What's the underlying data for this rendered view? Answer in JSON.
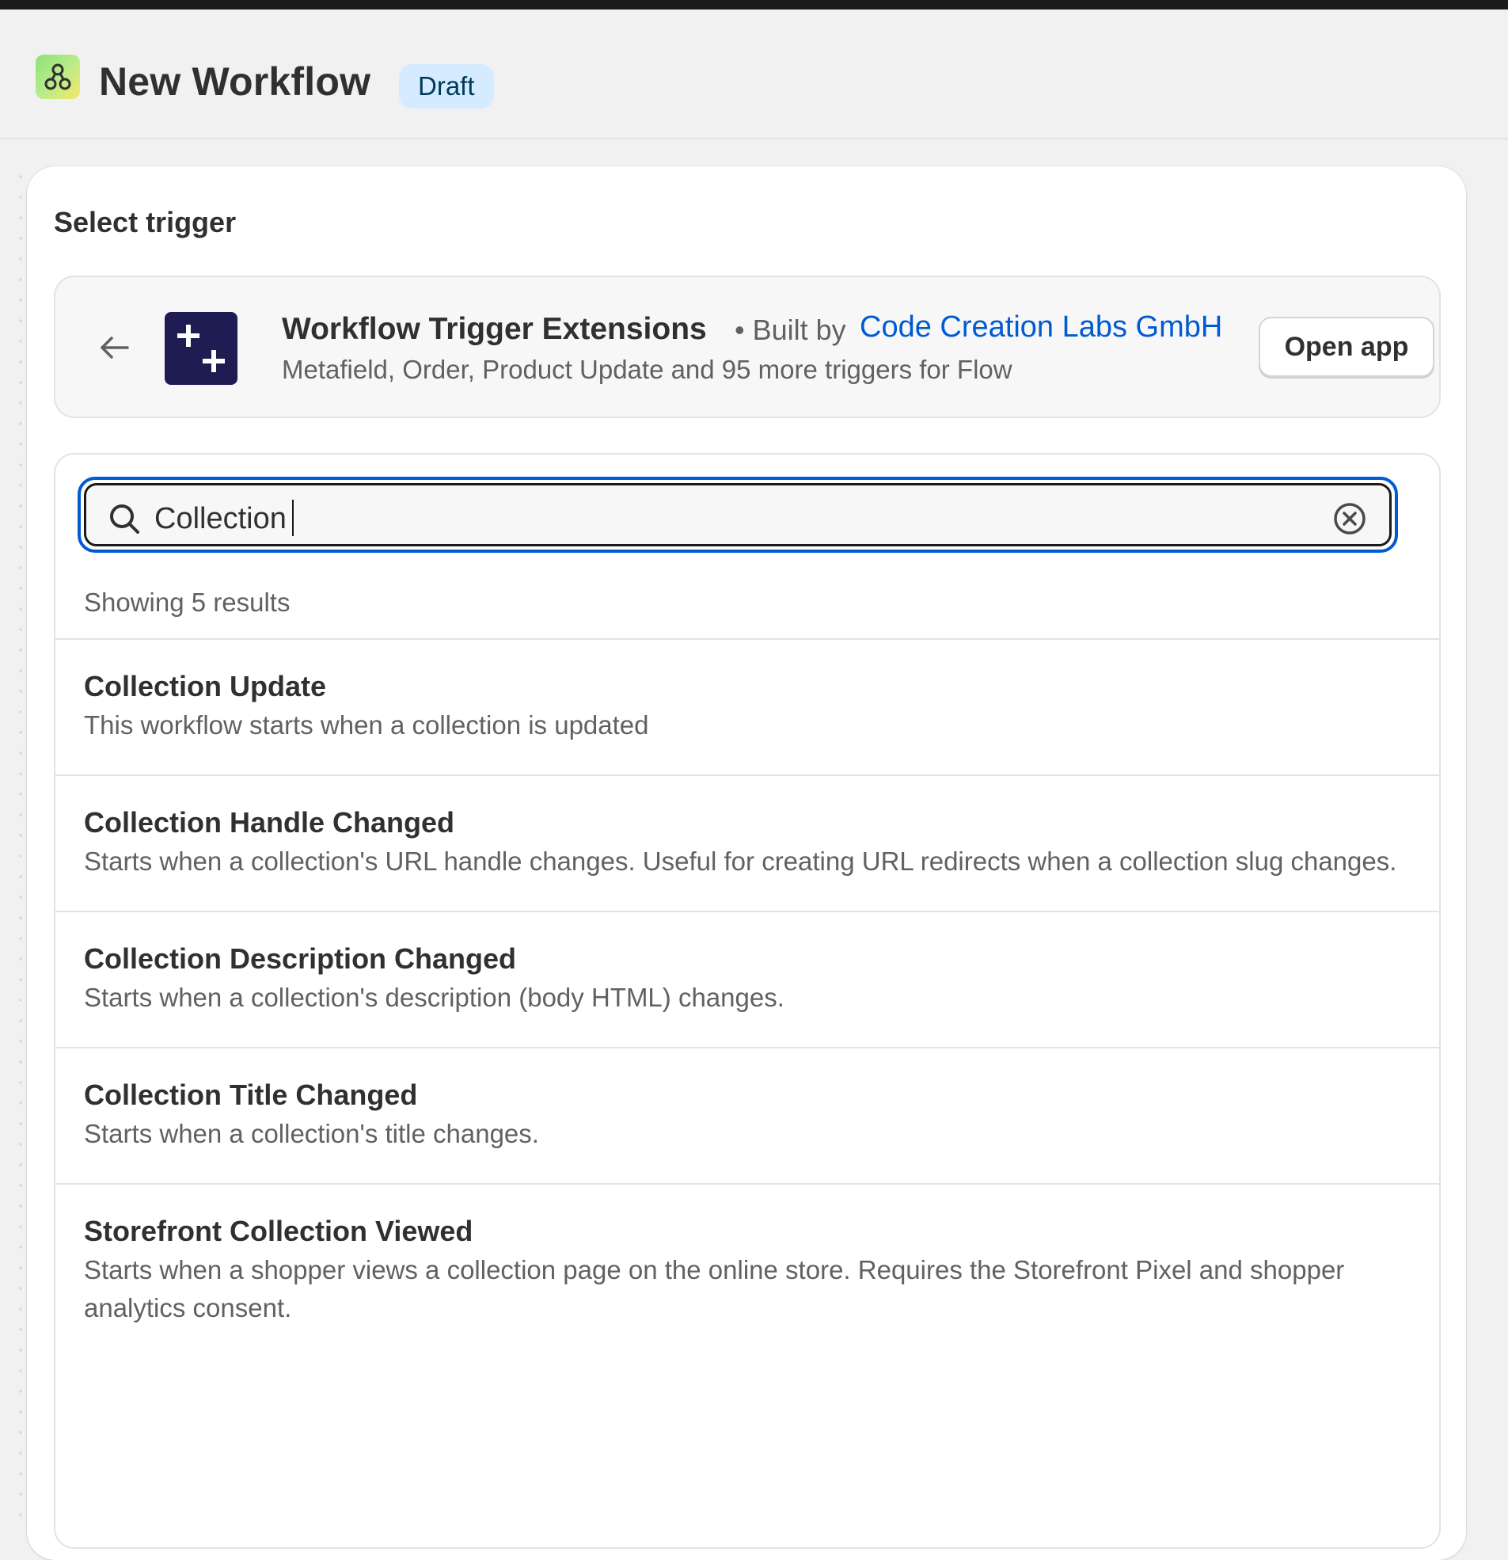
{
  "header": {
    "title": "New Workflow",
    "status": "Draft"
  },
  "panel": {
    "title": "Select trigger"
  },
  "app": {
    "name": "Workflow Trigger Extensions",
    "built_by_label": "• Built by",
    "developer": "Code Creation Labs GmbH",
    "description": "Metafield, Order, Product Update and 95 more triggers for Flow",
    "open_button": "Open app"
  },
  "search": {
    "value": "Collection",
    "placeholder": ""
  },
  "results_count": "Showing 5 results",
  "results": [
    {
      "title": "Collection Update",
      "description": "This workflow starts when a collection is updated"
    },
    {
      "title": "Collection Handle Changed",
      "description": "Starts when a collection's URL handle changes. Useful for creating URL redirects when a collection slug changes."
    },
    {
      "title": "Collection Description Changed",
      "description": "Starts when a collection's description (body HTML) changes."
    },
    {
      "title": "Collection Title Changed",
      "description": "Starts when a collection's title changes."
    },
    {
      "title": "Storefront Collection Viewed",
      "description": "Starts when a shopper views a collection page on the online store. Requires the Storefront Pixel and shopper analytics consent."
    }
  ],
  "colors": {
    "accent": "#005bd3",
    "badge_bg": "#d5ebff",
    "extension_logo": "#1f1c54"
  },
  "icons": {
    "app_logo": "flow-icon",
    "back": "arrow-left-icon",
    "extension_logo": "plus-plus-icon",
    "search": "search-icon",
    "clear": "x-circle-icon"
  }
}
